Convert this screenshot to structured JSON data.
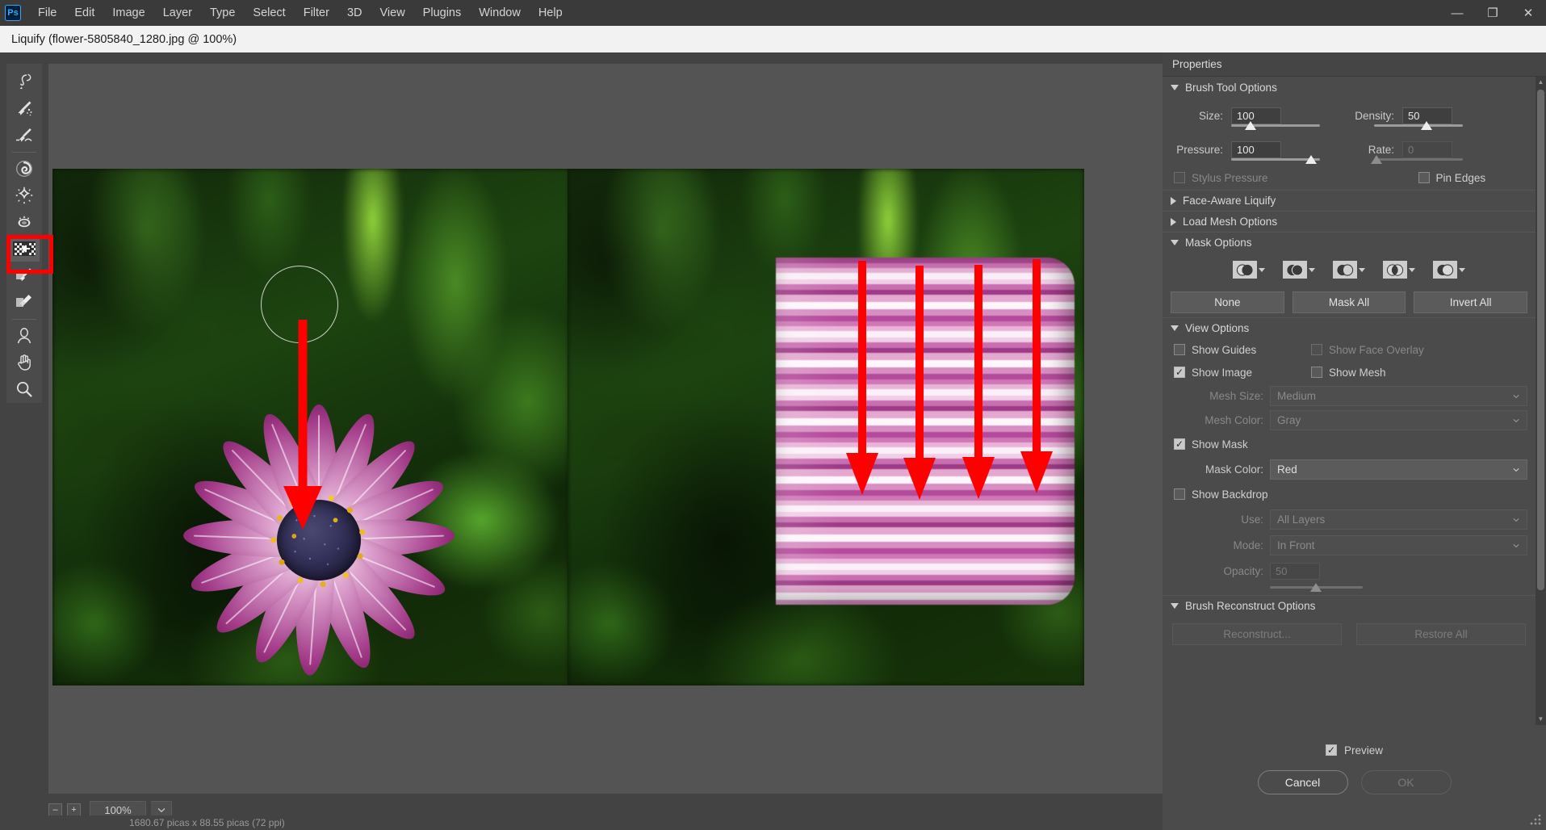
{
  "window": {
    "app_logo": "ps-logo",
    "menus": [
      "File",
      "Edit",
      "Image",
      "Layer",
      "Type",
      "Select",
      "Filter",
      "3D",
      "View",
      "Plugins",
      "Window",
      "Help"
    ],
    "controls": {
      "minimize": "—",
      "restore": "❐",
      "close": "✕"
    }
  },
  "dialog": {
    "title": "Liquify (flower-5805840_1280.jpg @ 100%)"
  },
  "toolbar": {
    "tools": [
      {
        "name": "forward-warp-tool",
        "title": "Forward Warp Tool",
        "selected": false
      },
      {
        "name": "reconstruct-tool",
        "title": "Reconstruct Tool",
        "selected": false
      },
      {
        "name": "smooth-tool",
        "title": "Smooth Tool",
        "selected": false
      },
      {
        "name": "twirl-clockwise-tool",
        "title": "Twirl Clockwise Tool",
        "selected": false
      },
      {
        "name": "pucker-tool",
        "title": "Pucker Tool",
        "selected": false
      },
      {
        "name": "bloat-tool",
        "title": "Bloat Tool",
        "selected": false
      },
      {
        "name": "push-left-tool",
        "title": "Push Left Tool",
        "selected": true
      },
      {
        "name": "freeze-mask-tool",
        "title": "Freeze Mask Tool",
        "selected": false
      },
      {
        "name": "thaw-mask-tool",
        "title": "Thaw Mask Tool",
        "selected": false
      },
      {
        "name": "face-tool",
        "title": "Face Tool",
        "selected": false
      },
      {
        "name": "hand-tool",
        "title": "Hand Tool",
        "selected": false
      },
      {
        "name": "zoom-tool",
        "title": "Zoom Tool",
        "selected": false
      }
    ],
    "highlight_color": "#ff0000"
  },
  "canvas": {
    "zoom_minus": "–",
    "zoom_plus": "+",
    "zoom_value": "100%",
    "status_text": "1680.67 picas x 88.55 picas (72 ppi)",
    "annotation_color": "#ff0000",
    "arrows_left": 1,
    "arrows_right": 4
  },
  "properties": {
    "header": "Properties",
    "brush_tool_options": {
      "title": "Brush Tool Options",
      "expanded": true,
      "size_label": "Size:",
      "size_value": "100",
      "density_label": "Density:",
      "density_value": "50",
      "pressure_label": "Pressure:",
      "pressure_value": "100",
      "rate_label": "Rate:",
      "rate_value": "0",
      "rate_enabled": false,
      "stylus_pressure_label": "Stylus Pressure",
      "stylus_pressure_checked": false,
      "stylus_pressure_enabled": false,
      "pin_edges_label": "Pin Edges",
      "pin_edges_checked": false
    },
    "face_aware_liquify": {
      "title": "Face-Aware Liquify",
      "expanded": false
    },
    "load_mesh_options": {
      "title": "Load Mesh Options",
      "expanded": false
    },
    "mask_options": {
      "title": "Mask Options",
      "expanded": true,
      "icons": [
        "mask-replace-selection-icon",
        "mask-add-to-selection-icon",
        "mask-subtract-from-selection-icon",
        "mask-intersect-with-selection-icon",
        "mask-invert-selection-icon"
      ],
      "buttons": [
        "None",
        "Mask All",
        "Invert All"
      ]
    },
    "view_options": {
      "title": "View Options",
      "expanded": true,
      "show_guides_label": "Show Guides",
      "show_guides_checked": false,
      "show_face_overlay_label": "Show Face Overlay",
      "show_face_overlay_checked": false,
      "show_face_overlay_enabled": false,
      "show_image_label": "Show Image",
      "show_image_checked": true,
      "show_mesh_label": "Show Mesh",
      "show_mesh_checked": false,
      "mesh_size_label": "Mesh Size:",
      "mesh_size_value": "Medium",
      "mesh_size_enabled": false,
      "mesh_color_label": "Mesh Color:",
      "mesh_color_value": "Gray",
      "mesh_color_enabled": false,
      "show_mask_label": "Show Mask",
      "show_mask_checked": true,
      "mask_color_label": "Mask Color:",
      "mask_color_value": "Red",
      "show_backdrop_label": "Show Backdrop",
      "show_backdrop_checked": false,
      "use_label": "Use:",
      "use_value": "All Layers",
      "mode_label": "Mode:",
      "mode_value": "In Front",
      "opacity_label": "Opacity:",
      "opacity_value": "50"
    },
    "brush_reconstruct_options": {
      "title": "Brush Reconstruct Options",
      "expanded": true,
      "reconstruct_button": "Reconstruct...",
      "restore_all_button": "Restore All",
      "buttons_enabled": false
    },
    "footer": {
      "preview_label": "Preview",
      "preview_checked": true,
      "cancel_button": "Cancel",
      "ok_button": "OK",
      "ok_enabled": false
    }
  }
}
